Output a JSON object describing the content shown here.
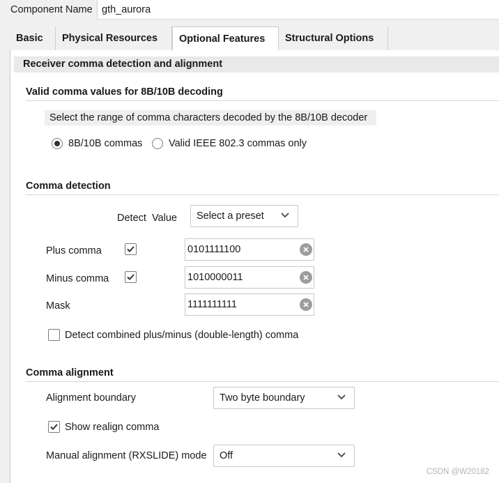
{
  "component_name": {
    "label": "Component Name",
    "value": "gth_aurora"
  },
  "tabs": [
    {
      "label": "Basic"
    },
    {
      "label": "Physical Resources"
    },
    {
      "label": "Optional Features"
    },
    {
      "label": "Structural Options"
    }
  ],
  "active_tab": "Optional Features",
  "section": {
    "title": "Receiver comma detection and alignment",
    "valid_comma": {
      "title": "Valid comma values for 8B/10B decoding",
      "description": "Select the range of comma characters decoded by the 8B/10B decoder",
      "options": [
        {
          "label": "8B/10B commas",
          "selected": true
        },
        {
          "label": "Valid IEEE 802.3 commas only",
          "selected": false
        }
      ]
    },
    "comma_detection": {
      "title": "Comma detection",
      "detect_value_label": "Detect  Value",
      "preset": {
        "value": "Select a preset",
        "icon": "chevron-down-icon"
      },
      "rows": [
        {
          "label": "Plus comma",
          "checked": true,
          "value": "0101111100"
        },
        {
          "label": "Minus comma",
          "checked": true,
          "value": "1010000011"
        },
        {
          "label": "Mask",
          "value": "1111111111"
        }
      ],
      "double_length": {
        "label": "Detect combined plus/minus (double-length) comma",
        "checked": false
      }
    },
    "comma_alignment": {
      "title": "Comma alignment",
      "alignment_boundary": {
        "label": "Alignment boundary",
        "value": "Two byte boundary"
      },
      "show_realign": {
        "label": "Show realign comma",
        "checked": true
      },
      "manual_alignment": {
        "label": "Manual alignment (RXSLIDE) mode",
        "value": "Off"
      }
    }
  },
  "watermark": "CSDN @W20182"
}
